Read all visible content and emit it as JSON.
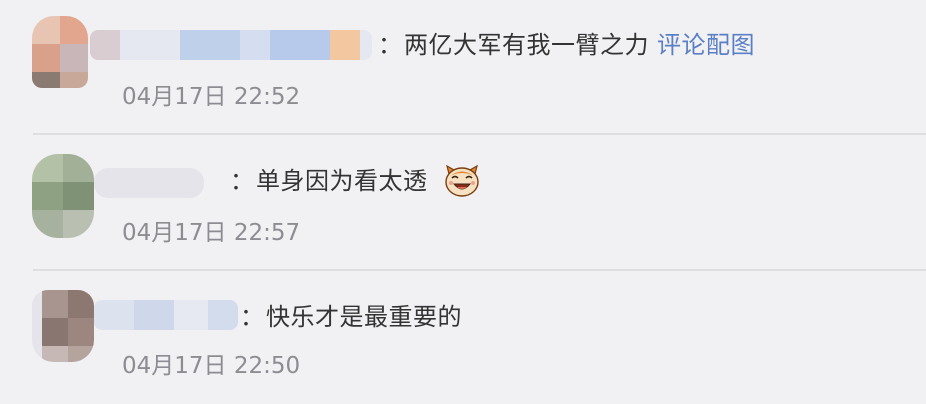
{
  "comments": [
    {
      "text": "两亿大军有我一臂之力",
      "link": "评论配图",
      "time": "04月17日 22:52",
      "colon": "："
    },
    {
      "text": "单身因为看太透",
      "emoji": "laughing-cat-emoji",
      "time": "04月17日 22:57",
      "colon": "："
    },
    {
      "text": "快乐才是最重要的",
      "time": "04月17日 22:50",
      "colon": "："
    }
  ],
  "colors": {
    "background": "#f1f1f4",
    "text": "#333333",
    "link": "#5a7fc4",
    "time": "#8c8c93",
    "divider": "#dedee3"
  }
}
